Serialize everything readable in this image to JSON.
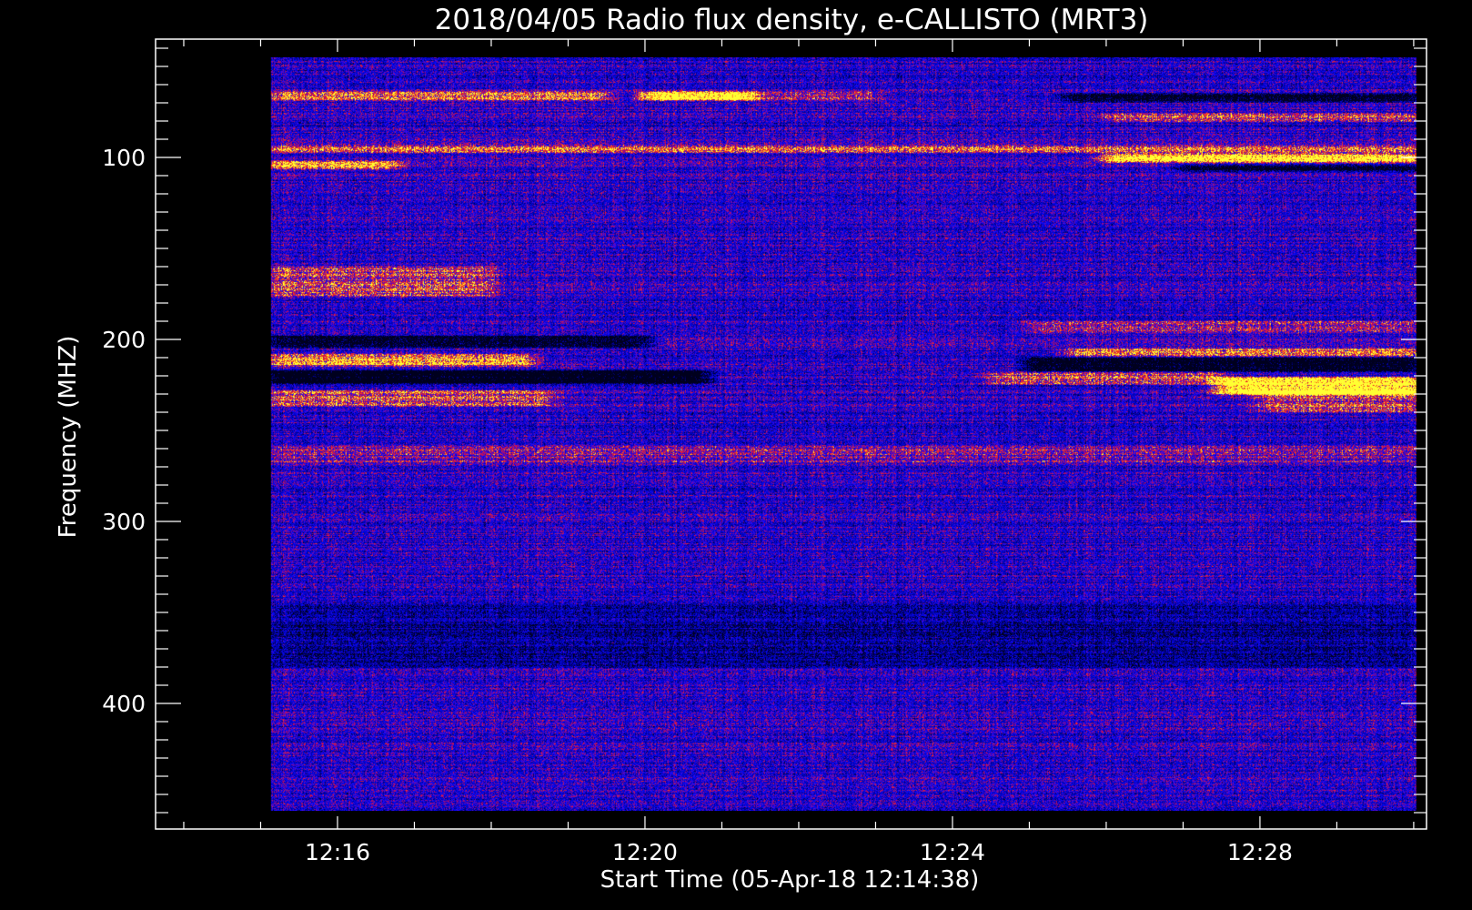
{
  "chart_data": {
    "type": "heatmap",
    "title": "2018/04/05  Radio flux density, e-CALLISTO (MRT3)",
    "xlabel": "Start Time (05-Apr-18 12:14:38)",
    "ylabel": "Frequency (MHZ)",
    "x_unit": "UT time (hh:mm)",
    "y_unit": "MHz",
    "xlim": [
      "12:13:38",
      "12:30:10"
    ],
    "ylim": [
      35,
      469
    ],
    "data_xlim": [
      "12:15:08",
      "12:30:02"
    ],
    "data_ylim": [
      45,
      459
    ],
    "y_axis_inverted": true,
    "x_ticks": [
      {
        "label": "12:16",
        "minutes": 16
      },
      {
        "label": "12:20",
        "minutes": 20
      },
      {
        "label": "12:24",
        "minutes": 24
      },
      {
        "label": "12:28",
        "minutes": 28
      }
    ],
    "x_minor_tick_interval_minutes": 1,
    "y_ticks": [
      {
        "label": "100",
        "value": 100
      },
      {
        "label": "200",
        "value": 200
      },
      {
        "label": "300",
        "value": 300
      },
      {
        "label": "400",
        "value": 400
      }
    ],
    "y_minor_tick_interval": 10,
    "colormap": [
      "#000000",
      "#0000ff",
      "#ff0000",
      "#ffff00"
    ],
    "background_color": "#0d0dc8",
    "grid": false,
    "legend": "none",
    "features": [
      {
        "kind": "emission-band",
        "freq_mhz": [
          64,
          68
        ],
        "time": [
          "12:15:08",
          "12:19:30"
        ],
        "intensity": 0.55
      },
      {
        "kind": "bright-burst",
        "freq_mhz": [
          64,
          68
        ],
        "time": [
          "12:20:00",
          "12:21:20"
        ],
        "intensity": 1.0
      },
      {
        "kind": "emission-band",
        "freq_mhz": [
          64,
          68
        ],
        "time": [
          "12:21:20",
          "12:23:00"
        ],
        "intensity": 0.35
      },
      {
        "kind": "dark-band",
        "freq_mhz": [
          65,
          69
        ],
        "time": [
          "12:25:30",
          "12:30:02"
        ],
        "intensity": -0.6
      },
      {
        "kind": "emission-band",
        "freq_mhz": [
          76,
          80
        ],
        "time": [
          "12:26:00",
          "12:30:02"
        ],
        "intensity": 0.35
      },
      {
        "kind": "emission-band",
        "freq_mhz": [
          93,
          97
        ],
        "time": [
          "12:15:08",
          "12:30:02"
        ],
        "intensity": 0.4
      },
      {
        "kind": "bright-band",
        "freq_mhz": [
          98,
          102
        ],
        "time": [
          "12:26:00",
          "12:30:02"
        ],
        "intensity": 0.85
      },
      {
        "kind": "emission-band",
        "freq_mhz": [
          102,
          106
        ],
        "time": [
          "12:15:08",
          "12:16:45"
        ],
        "intensity": 0.55
      },
      {
        "kind": "dark-band",
        "freq_mhz": [
          104,
          107
        ],
        "time": [
          "12:27:00",
          "12:30:02"
        ],
        "intensity": -0.6
      },
      {
        "kind": "emission-band",
        "freq_mhz": [
          160,
          176
        ],
        "time": [
          "12:15:08",
          "12:18:00"
        ],
        "intensity": 0.35
      },
      {
        "kind": "emission-band",
        "freq_mhz": [
          190,
          196
        ],
        "time": [
          "12:25:00",
          "12:30:02"
        ],
        "intensity": 0.3
      },
      {
        "kind": "dark-band",
        "freq_mhz": [
          198,
          204
        ],
        "time": [
          "12:15:08",
          "12:20:00"
        ],
        "intensity": -0.7
      },
      {
        "kind": "emission-band",
        "freq_mhz": [
          205,
          209
        ],
        "time": [
          "12:25:30",
          "12:30:02"
        ],
        "intensity": 0.55
      },
      {
        "kind": "emission-band",
        "freq_mhz": [
          208,
          214
        ],
        "time": [
          "12:15:08",
          "12:18:30"
        ],
        "intensity": 0.6
      },
      {
        "kind": "dark-band",
        "freq_mhz": [
          210,
          217
        ],
        "time": [
          "12:25:00",
          "12:30:02"
        ],
        "intensity": -0.75
      },
      {
        "kind": "dark-band",
        "freq_mhz": [
          217,
          224
        ],
        "time": [
          "12:15:08",
          "12:20:45"
        ],
        "intensity": -0.85
      },
      {
        "kind": "emission-band",
        "freq_mhz": [
          218,
          224
        ],
        "time": [
          "12:24:30",
          "12:27:30"
        ],
        "intensity": 0.4
      },
      {
        "kind": "bright-band",
        "freq_mhz": [
          221,
          230
        ],
        "time": [
          "12:27:30",
          "12:30:02"
        ],
        "intensity": 0.95
      },
      {
        "kind": "emission-band",
        "freq_mhz": [
          228,
          236
        ],
        "time": [
          "12:15:08",
          "12:18:45"
        ],
        "intensity": 0.4
      },
      {
        "kind": "emission-band",
        "freq_mhz": [
          228,
          240
        ],
        "time": [
          "12:28:00",
          "12:30:02"
        ],
        "intensity": 0.35
      },
      {
        "kind": "emission-band",
        "freq_mhz": [
          258,
          268
        ],
        "time": [
          "12:15:08",
          "12:30:02"
        ],
        "intensity": 0.2
      },
      {
        "kind": "quiet-region",
        "freq_mhz": [
          345,
          380
        ],
        "time": [
          "12:15:08",
          "12:30:02"
        ],
        "intensity": -0.25
      }
    ]
  }
}
